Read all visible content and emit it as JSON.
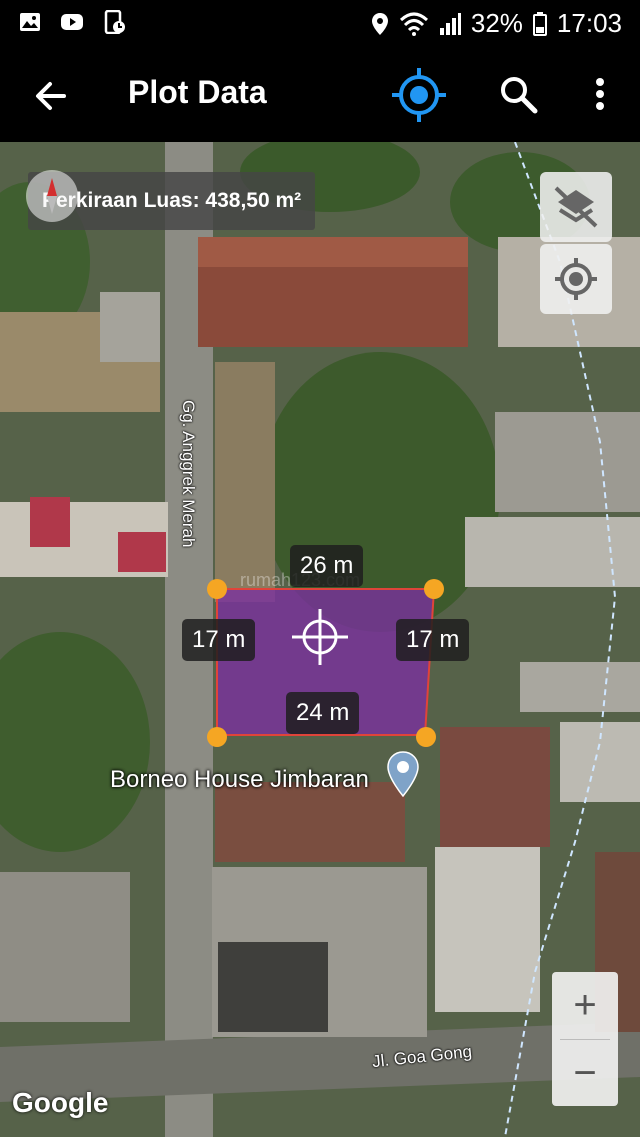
{
  "status_bar": {
    "battery": "32%",
    "time": "17:03",
    "left_icons": [
      "gallery-icon",
      "youtube-icon",
      "phone-sync-icon"
    ],
    "right_icons": [
      "location-pin-icon",
      "wifi-icon",
      "signal-icon",
      "battery-icon"
    ]
  },
  "app_bar": {
    "title": "Plot Data",
    "accent": "#2196F3"
  },
  "map": {
    "area_label": "Perkiraan Luas: 438,50 m²",
    "measurements": {
      "top": "26 m",
      "left": "17 m",
      "right": "17 m",
      "bottom": "24 m"
    },
    "polygon_fill": "#7b2fa0",
    "corner_color": "#f5a623",
    "poi_label": "Borneo House Jimbaran",
    "streets": {
      "vertical": "Gg. Anggrek Merah",
      "horizontal": "Jl. Goa Gong"
    },
    "watermark": "rumah123.com",
    "attribution": "Google",
    "controls": {
      "zoom_in": "+",
      "zoom_out": "−"
    }
  }
}
